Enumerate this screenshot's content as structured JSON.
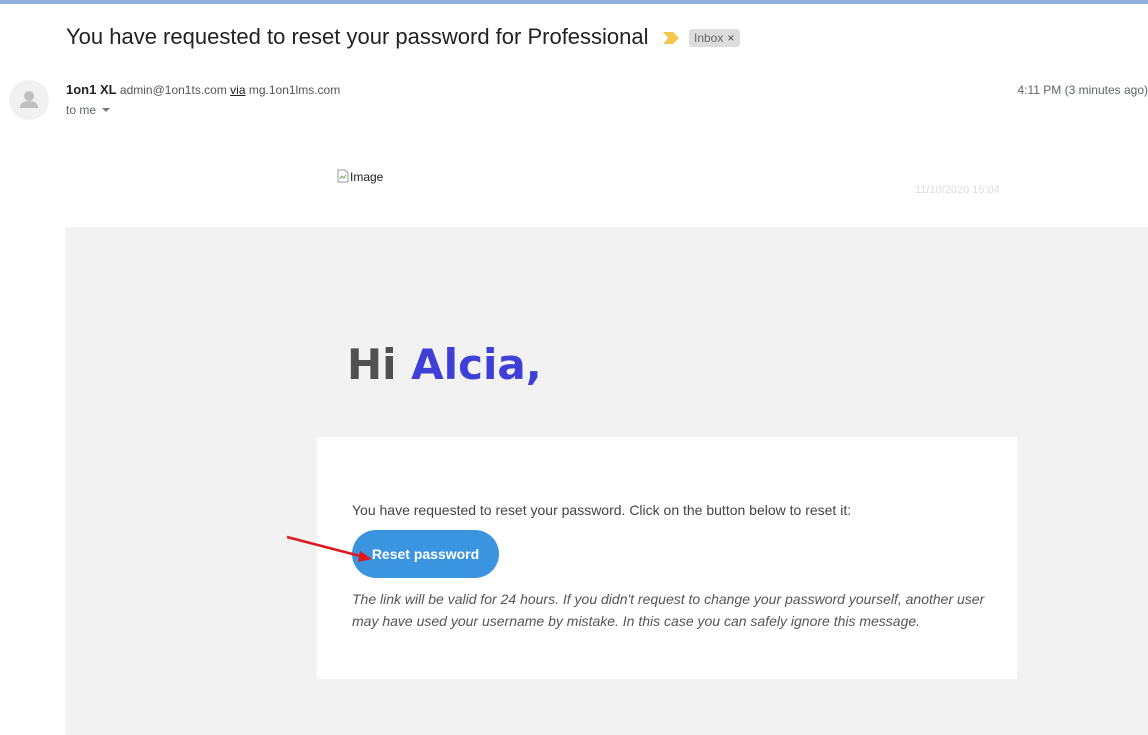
{
  "email": {
    "subject": "You have requested to reset your password for Professional",
    "label_tag": "Inbox",
    "label_remove": "×",
    "sender": {
      "name": "1on1 XL",
      "address": "admin@1on1ts.com",
      "via_label": "via",
      "via_domain": "mg.1on1lms.com"
    },
    "recipient": "to me",
    "time": "4:11 PM (3 minutes ago)"
  },
  "body": {
    "image_alt": "Image",
    "date": "11/10/2020 15:04",
    "greeting_prefix": "Hi",
    "greeting_name": "Alcia,",
    "message": "You have requested to reset your password. Click on the button below to reset it:",
    "button_label": "Reset password",
    "note": "The link will be valid for 24 hours. If you didn't request to change your password yourself, another user may have used your username by mistake. In this case you can safely ignore this message."
  },
  "colors": {
    "accent_name": "#3d3fd6",
    "button": "#3b94e0",
    "annotation_arrow": "#e0191f",
    "importance_marker": "#f2c94c"
  },
  "icons": {
    "avatar": "person-icon",
    "importance": "importance-marker-icon",
    "recipient_caret": "caret-down-icon",
    "broken_image": "broken-image-icon"
  }
}
